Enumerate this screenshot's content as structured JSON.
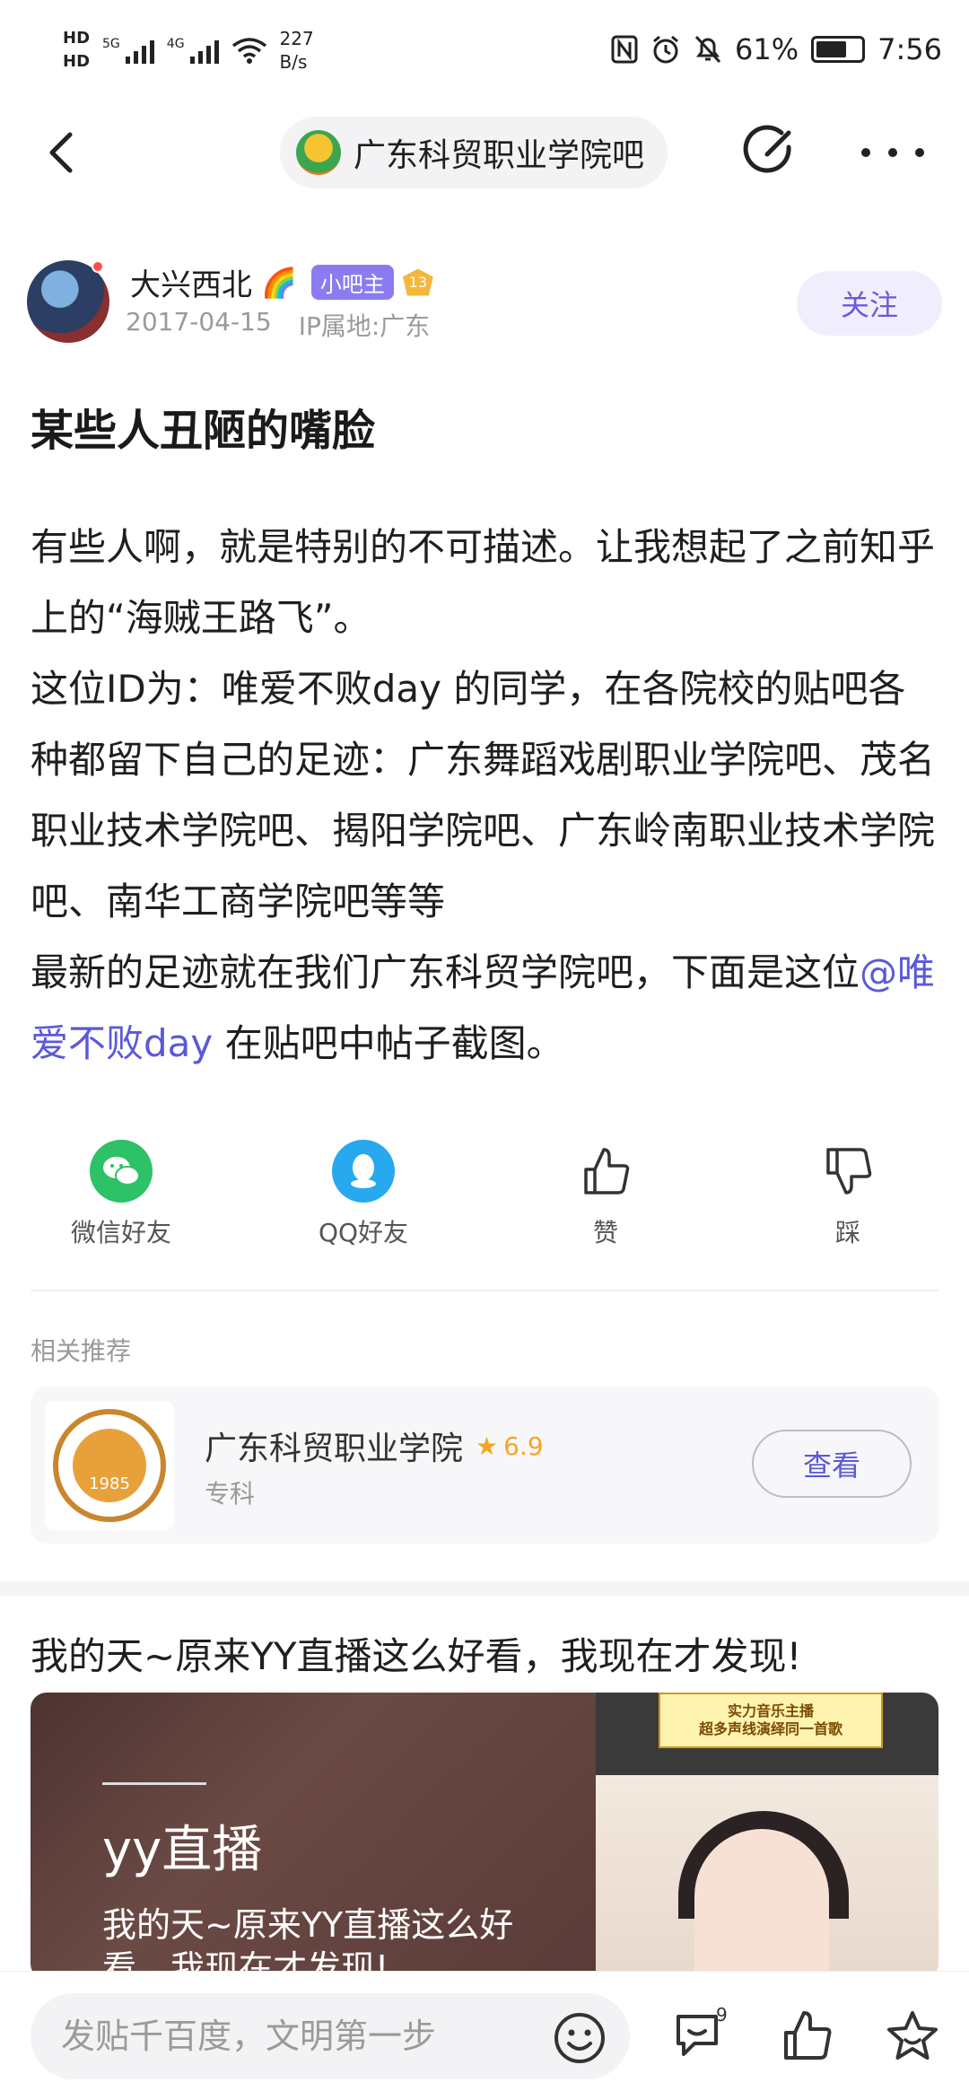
{
  "status_bar": {
    "hd_top": "HD",
    "hd_bottom": "HD",
    "signal_1": "5G",
    "signal_2": "4G",
    "speed_value": "227",
    "speed_unit": "B/s",
    "battery": "61%",
    "time": "7:56"
  },
  "nav": {
    "forum_name": "广东科贸职业学院吧"
  },
  "author": {
    "name": "大兴西北",
    "emoji": "🌈",
    "badge": "小吧主",
    "level": "13",
    "date": "2017-04-15",
    "ip": "IP属地:广东",
    "follow_label": "关注"
  },
  "post": {
    "title": "某些人丑陋的嘴脸",
    "para1": "有些人啊，就是特别的不可描述。让我想起了之前知乎上的“海贼王路飞”。",
    "para2": "这位ID为：唯爱不败day 的同学，在各院校的贴吧各种都留下自己的足迹：广东舞蹈戏剧职业学院吧、茂名职业技术学院吧、揭阳学院吧、广东岭南职业技术学院吧、南华工商学院吧等等",
    "para3_before": "最新的足迹就在我们广东科贸学院吧，下面是这位",
    "para3_mention": "@唯爱不败day",
    "para3_after": " 在贴吧中帖子截图。"
  },
  "share": {
    "wechat": "微信好友",
    "qq": "QQ好友",
    "like": "赞",
    "dislike": "踩"
  },
  "related": {
    "heading": "相关推荐",
    "school_name": "广东科贸职业学院",
    "rating": "6.9",
    "school_type": "专科",
    "view_label": "查看",
    "logo_year": "1985"
  },
  "ad": {
    "title": "我的天~原来YY直播这么好看，我现在才发现!",
    "brand": "yy直播",
    "subtitle": "我的天~原来YY直播这么好看，我现在才发现!",
    "banner_line1": "实力音乐主播",
    "banner_line2": "超多声线演绎同一首歌"
  },
  "bottom": {
    "placeholder": "发贴千百度，文明第一步",
    "reply_count": "9"
  },
  "colors": {
    "accent": "#5a59d9",
    "badge_purple": "#8a7cf0",
    "wechat_green": "#2dc168",
    "qq_blue": "#28a8ef",
    "star_orange": "#f5a623"
  }
}
